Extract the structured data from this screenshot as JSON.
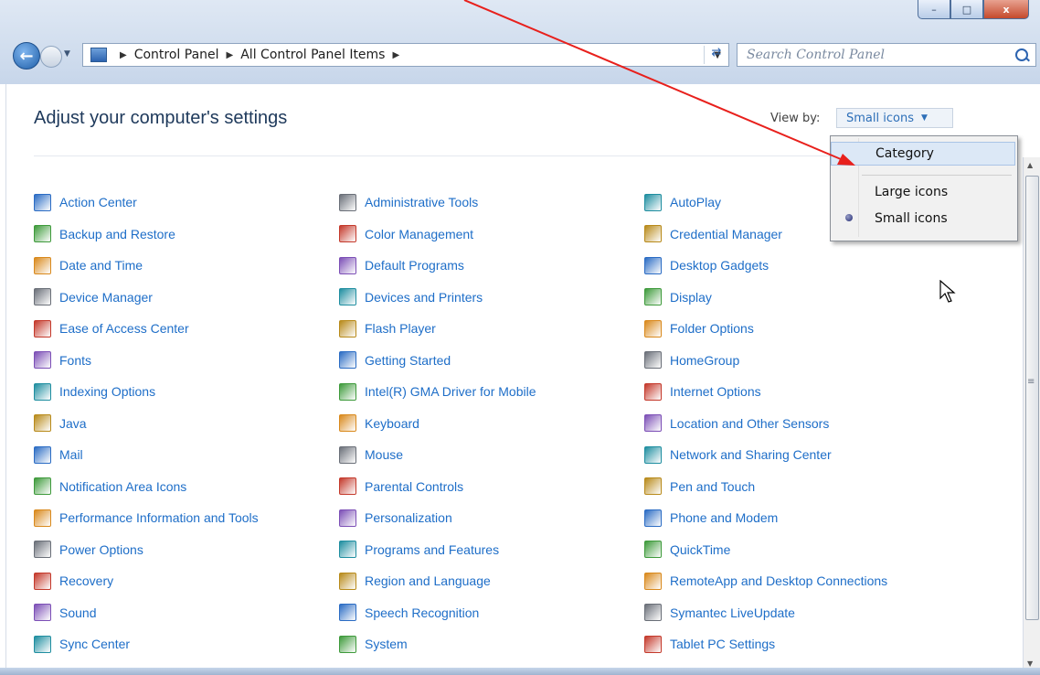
{
  "window": {
    "controls": {
      "minimize": "–",
      "maximize": "□",
      "close": "x"
    }
  },
  "nav": {
    "breadcrumb": [
      "Control Panel",
      "All Control Panel Items"
    ],
    "search_placeholder": "Search Control Panel"
  },
  "header": {
    "title": "Adjust your computer's settings",
    "view_by_label": "View by:",
    "view_by_value": "Small icons"
  },
  "view_menu": {
    "options": [
      "Category",
      "Large icons",
      "Small icons"
    ],
    "selected": "Small icons"
  },
  "items": {
    "col1": [
      "Action Center",
      "Backup and Restore",
      "Date and Time",
      "Device Manager",
      "Ease of Access Center",
      "Fonts",
      "Indexing Options",
      "Java",
      "Mail",
      "Notification Area Icons",
      "Performance Information and Tools",
      "Power Options",
      "Recovery",
      "Sound",
      "Sync Center"
    ],
    "col2": [
      "Administrative Tools",
      "Color Management",
      "Default Programs",
      "Devices and Printers",
      "Flash Player",
      "Getting Started",
      "Intel(R) GMA Driver for Mobile",
      "Keyboard",
      "Mouse",
      "Parental Controls",
      "Personalization",
      "Programs and Features",
      "Region and Language",
      "Speech Recognition",
      "System"
    ],
    "col3": [
      "AutoPlay",
      "Credential Manager",
      "Desktop Gadgets",
      "Display",
      "Folder Options",
      "HomeGroup",
      "Internet Options",
      "Location and Other Sensors",
      "Network and Sharing Center",
      "Pen and Touch",
      "Phone and Modem",
      "QuickTime",
      "RemoteApp and Desktop Connections",
      "Symantec LiveUpdate",
      "Tablet PC Settings"
    ]
  },
  "colors": {
    "link": "#1e6ec8",
    "title": "#1e395b",
    "annotation_arrow": "#e8201c"
  }
}
